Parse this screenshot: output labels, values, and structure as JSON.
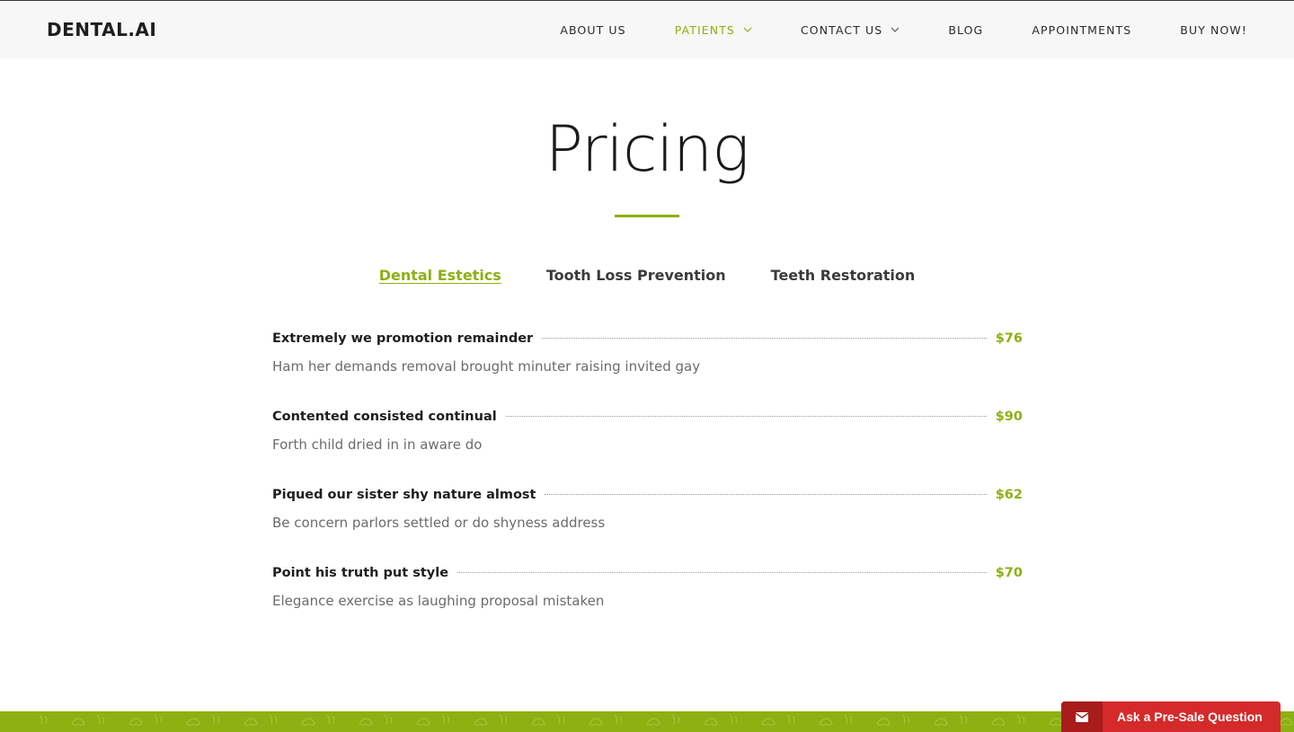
{
  "brand": {
    "logo": "DENTAL.AI",
    "accent_color": "#8db012"
  },
  "nav": {
    "items": [
      {
        "label": "ABOUT US",
        "active": false,
        "has_dropdown": false
      },
      {
        "label": "PATIENTS",
        "active": true,
        "has_dropdown": true
      },
      {
        "label": "CONTACT US",
        "active": false,
        "has_dropdown": true
      },
      {
        "label": "BLOG",
        "active": false,
        "has_dropdown": false
      },
      {
        "label": "APPOINTMENTS",
        "active": false,
        "has_dropdown": false
      },
      {
        "label": "BUY NOW!",
        "active": false,
        "has_dropdown": false
      }
    ]
  },
  "page": {
    "title": "Pricing"
  },
  "tabs": [
    {
      "label": "Dental Estetics",
      "active": true
    },
    {
      "label": "Tooth Loss Prevention",
      "active": false
    },
    {
      "label": "Teeth Restoration",
      "active": false
    }
  ],
  "pricing": [
    {
      "name": "Extremely we promotion remainder",
      "price": "$76",
      "description": "Ham her demands removal brought minuter raising invited gay"
    },
    {
      "name": "Contented consisted continual",
      "price": "$90",
      "description": "Forth child dried in in aware do"
    },
    {
      "name": "Piqued our sister shy nature almost",
      "price": "$62",
      "description": "Be concern parlors settled or do shyness address"
    },
    {
      "name": "Point his truth put style",
      "price": "$70",
      "description": "Elegance exercise as laughing proposal mistaken"
    }
  ],
  "presale": {
    "label": "Ask a Pre-Sale Question",
    "icon": "envelope-icon",
    "color": "#d42a2a"
  }
}
